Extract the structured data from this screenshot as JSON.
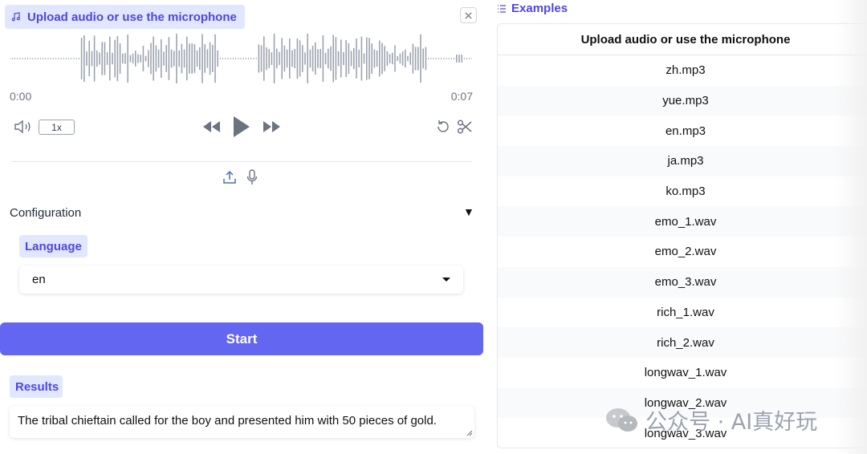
{
  "audio": {
    "label": "Upload audio or use the microphone",
    "time_start": "0:00",
    "time_end": "0:07",
    "playback_rate": "1x"
  },
  "config": {
    "title": "Configuration",
    "toggle": "▼",
    "language_label": "Language",
    "language_value": "en"
  },
  "start_label": "Start",
  "results": {
    "label": "Results",
    "text": "The tribal chieftain called for the boy and presented him with 50 pieces of gold."
  },
  "examples": {
    "title": "Examples",
    "column_header": "Upload audio or use the microphone",
    "items": [
      "zh.mp3",
      "yue.mp3",
      "en.mp3",
      "ja.mp3",
      "ko.mp3",
      "emo_1.wav",
      "emo_2.wav",
      "emo_3.wav",
      "rich_1.wav",
      "rich_2.wav",
      "longwav_1.wav",
      "longwav_2.wav",
      "longwav_3.wav"
    ]
  },
  "watermark": "公众号 · AI真好玩",
  "colors": {
    "accent": "#6366f1",
    "badge_bg": "#e0e7ff",
    "badge_text": "#4f46e5",
    "waveform": "#9ca3af"
  }
}
